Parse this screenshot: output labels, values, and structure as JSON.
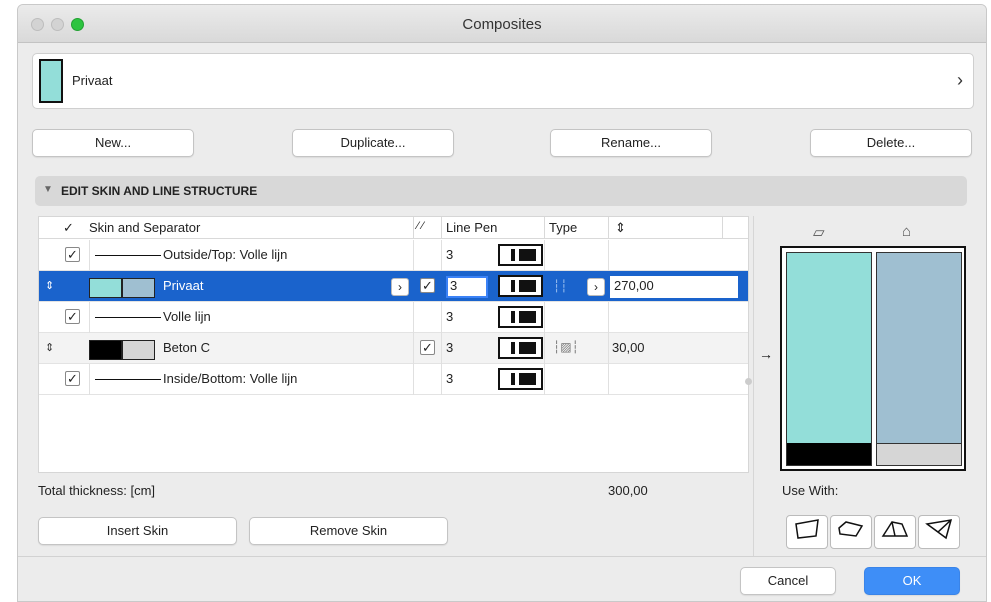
{
  "window": {
    "title": "Composites"
  },
  "selector": {
    "name": "Privaat",
    "chevron": "›"
  },
  "buttons": {
    "new": "New...",
    "duplicate": "Duplicate...",
    "rename": "Rename...",
    "delete": "Delete..."
  },
  "section": {
    "label": "EDIT SKIN AND LINE STRUCTURE"
  },
  "table": {
    "headers": {
      "check": "✓",
      "skin": "Skin and Separator",
      "line_pen": "Line Pen",
      "type": "Type"
    },
    "rows": [
      {
        "kind": "separator",
        "label": "Outside/Top: Volle lijn",
        "pen": "3",
        "checked": true
      },
      {
        "kind": "skin",
        "label": "Privaat",
        "pen": "3",
        "thickness": "270,00",
        "selected": true,
        "swatch_fill": "#93ded9",
        "swatch_bg": "#9fbfd1"
      },
      {
        "kind": "separator",
        "label": "Volle lijn",
        "pen": "3",
        "checked": true
      },
      {
        "kind": "skin",
        "label": "Beton C",
        "pen": "3",
        "thickness": "30,00",
        "swatch_fill": "#000000",
        "swatch_bg": "#d6d6d6"
      },
      {
        "kind": "separator",
        "label": "Inside/Bottom: Volle lijn",
        "pen": "3",
        "checked": true
      }
    ]
  },
  "footer": {
    "total_label": "Total thickness: [cm]",
    "total_value": "300,00",
    "use_with": "Use With:"
  },
  "skin_buttons": {
    "insert": "Insert Skin",
    "remove": "Remove Skin"
  },
  "dialog": {
    "cancel": "Cancel",
    "ok": "OK"
  },
  "icons": [
    "hatch-icon",
    "paint-brush-icon",
    "arrow-right-icon",
    "wall-shape-icon",
    "slab-shape-icon",
    "roof-shape-icon",
    "shell-shape-icon"
  ],
  "colors": {
    "accent": "#1a63cc",
    "skin_cyan": "#93ded9",
    "skin_blue": "#9fbfd1"
  }
}
